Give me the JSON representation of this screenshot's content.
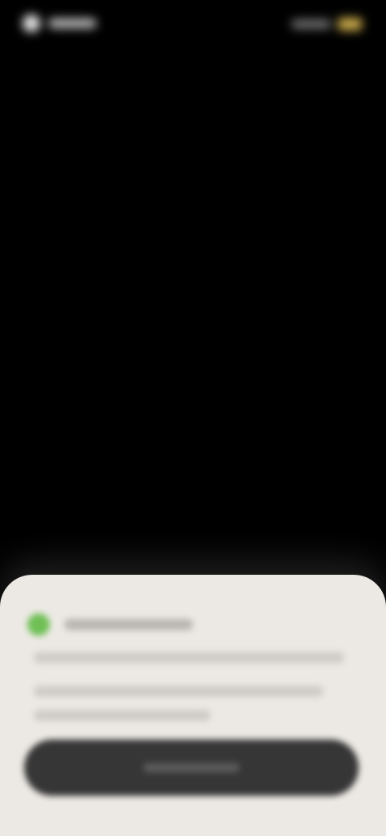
{
  "status_bar": {
    "left_icon": "status-dot-icon",
    "right_icon": "battery-icon"
  },
  "sheet": {
    "app_icon": "app-icon",
    "accent_color": "#6fbf55",
    "button_color": "#363636",
    "background_color": "#ece9e4"
  }
}
